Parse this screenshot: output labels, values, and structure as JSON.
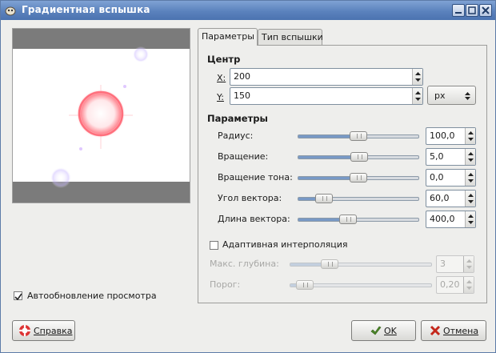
{
  "window": {
    "title": "Градиентная вспышка"
  },
  "preview": {
    "auto_update_label": "Автообновление просмотра",
    "auto_update_checked": true
  },
  "tabs": [
    {
      "label": "Параметры",
      "active": true
    },
    {
      "label": "Тип вспышки",
      "active": false
    }
  ],
  "center": {
    "heading": "Центр",
    "x_label": "X:",
    "x_value": "200",
    "y_label": "Y:",
    "y_value": "150",
    "unit": "px"
  },
  "params": {
    "heading": "Параметры",
    "sliders": [
      {
        "label": "Радиус:",
        "value": "100,0",
        "fraction": 0.5
      },
      {
        "label": "Вращение:",
        "value": "5,0",
        "fraction": 0.51
      },
      {
        "label": "Вращение тона:",
        "value": "0,0",
        "fraction": 0.5
      },
      {
        "label": "Угол вектора:",
        "value": "60,0",
        "fraction": 0.17
      },
      {
        "label": "Длина вектора:",
        "value": "400,0",
        "fraction": 0.4
      }
    ],
    "adaptive_label": "Адаптивная интерполяция",
    "adaptive_checked": false,
    "disabled_sliders": [
      {
        "label": "Макс. глубина:",
        "value": "3",
        "fraction": 0.25
      },
      {
        "label": "Порог:",
        "value": "0,20",
        "fraction": 0.05
      }
    ]
  },
  "buttons": {
    "help": "Справка",
    "ok": "OK",
    "cancel": "Отмена"
  }
}
